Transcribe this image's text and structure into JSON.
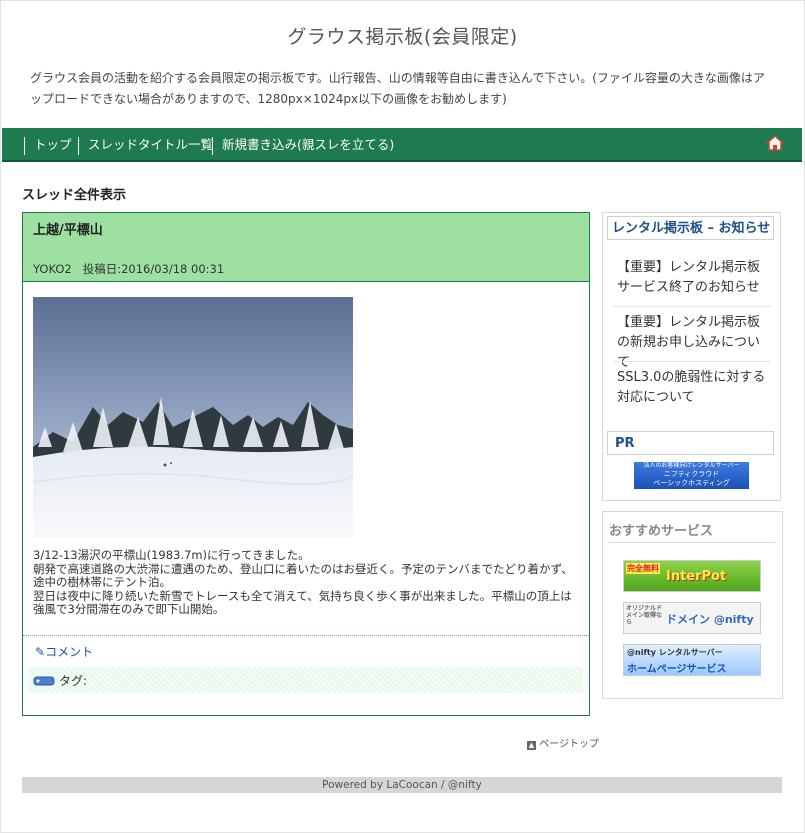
{
  "site": {
    "title": "グラウス掲示板(会員限定)",
    "description": "グラウス会員の活動を紹介する会員限定の掲示板です。山行報告、山の情報等自由に書き込んで下さい。(ファイル容量の大きな画像はアップロードできない場合がありますので、1280px×1024px以下の画像をお勧めします)"
  },
  "nav": {
    "items": [
      "トップ",
      "スレッドタイトル一覧",
      "新規書き込み(親スレを立てる)"
    ],
    "home_icon": "home-icon"
  },
  "main": {
    "section_title": "スレッド全件表示",
    "thread": {
      "subject": "上越/平標山",
      "author": "YOKO2",
      "date_label": "投稿日:2016/03/18 00:31",
      "body_lines": [
        "3/12-13湯沢の平標山(1983.7m)に行ってきました。",
        "朝発で高速道路の大渋滞に遭遇のため、登山口に着いたのはお昼近く。予定のテンバまでたどり着かず、途中の樹林帯にテント泊。",
        "翌日は夜中に降り続いた新雪でトレースも全て消えて、気持ち良く歩く事が出来ました。平標山の頂上は強風で3分間滞在のみで即下山開始。"
      ],
      "comment_label": "コメント",
      "tag_label": "タグ:"
    },
    "page_top_label": "ページトップ"
  },
  "sidebar": {
    "news_title": "レンタル掲示板 – お知らせ",
    "news_items": [
      "【重要】レンタル掲示板サービス終了のお知らせ",
      "【重要】レンタル掲示板の新規お申し込みについて",
      "SSL3.0の脆弱性に対する対応について"
    ],
    "pr_title": "PR",
    "pr_banner_lines": [
      "法人のお客様向けレンタルサーバー",
      "ニフティクラウド",
      "ベーシックホスティング"
    ],
    "recommend_title": "おすすめサービス",
    "banners": [
      {
        "line1": "完全無料",
        "line2": "InterPot"
      },
      {
        "line1": "オリジナルドメイン取得なら",
        "line2": "ドメイン @nifty"
      },
      {
        "line1": "@nifty レンタルサーバー",
        "line2": "ホームページサービス"
      }
    ]
  },
  "footer": {
    "text": "Powered by LaCoocan / @nifty"
  }
}
